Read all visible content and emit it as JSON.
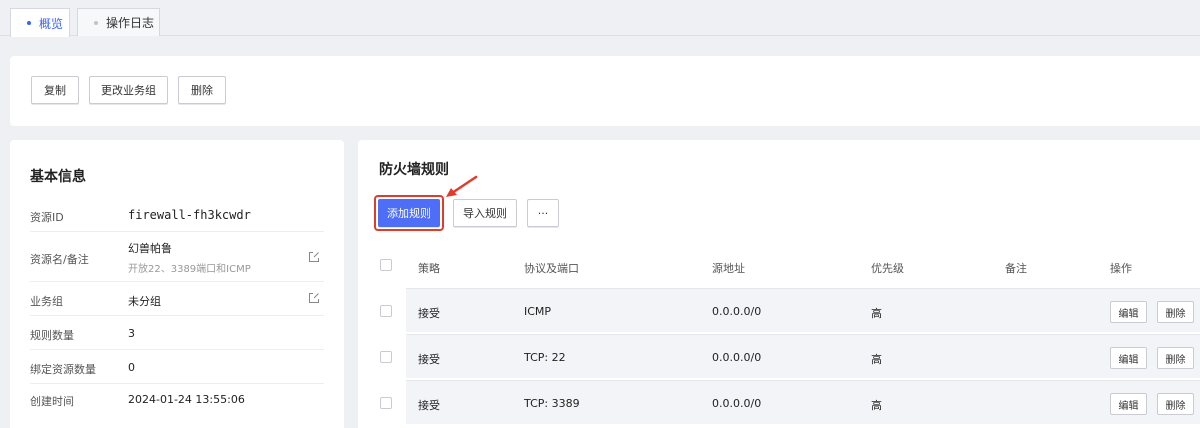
{
  "tabs": [
    {
      "label": "概览",
      "active": true
    },
    {
      "label": "操作日志",
      "active": false
    }
  ],
  "toolbar": {
    "copy_label": "复制",
    "change_group_label": "更改业务组",
    "delete_label": "删除"
  },
  "basic_info": {
    "title": "基本信息",
    "rows": [
      {
        "label": "资源ID",
        "value": "firewall-fh3kcwdr"
      },
      {
        "label": "资源名/备注",
        "value": "幻兽帕鲁",
        "sub": "开放22、3389端口和ICMP"
      },
      {
        "label": "业务组",
        "value": "未分组"
      },
      {
        "label": "规则数量",
        "value": "3"
      },
      {
        "label": "绑定资源数量",
        "value": "0"
      },
      {
        "label": "创建时间",
        "value": "2024-01-24 13:55:06"
      }
    ]
  },
  "rules": {
    "title": "防火墙规则",
    "add_label": "添加规则",
    "import_label": "导入规则",
    "more_label": "···",
    "columns": [
      "策略",
      "协议及端口",
      "源地址",
      "优先级",
      "备注",
      "操作"
    ],
    "rows": [
      {
        "policy": "接受",
        "protocol": "ICMP",
        "source": "0.0.0.0/0",
        "priority": "高",
        "note": ""
      },
      {
        "policy": "接受",
        "protocol": "TCP: 22",
        "source": "0.0.0.0/0",
        "priority": "高",
        "note": ""
      },
      {
        "policy": "接受",
        "protocol": "TCP: 3389",
        "source": "0.0.0.0/0",
        "priority": "高",
        "note": ""
      }
    ],
    "edit_label": "编辑",
    "delete_label": "删除"
  },
  "colors": {
    "accent": "#4f6ef7",
    "highlight": "#e03c2b"
  }
}
